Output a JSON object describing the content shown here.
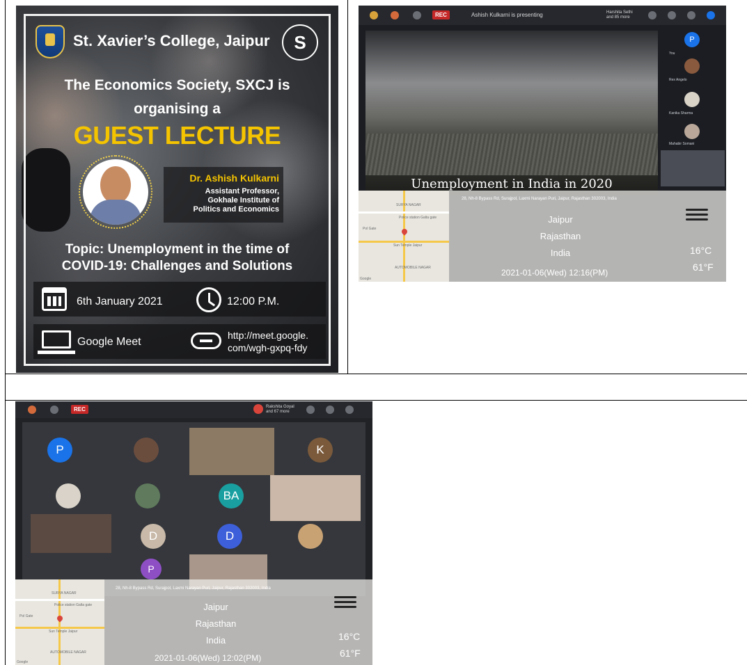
{
  "poster": {
    "college": "St. Xavier’s College, Jaipur",
    "society_logo_letter": "S",
    "line1": "The Economics Society, SXCJ is",
    "line2": "organising a",
    "event_type": "GUEST LECTURE",
    "speaker_name": "Dr. Ashish Kulkarni",
    "speaker_role_1": "Assistant Professor,",
    "speaker_role_2": "Gokhale Institute of",
    "speaker_role_3": "Politics and Economics",
    "topic_1": "Topic: Unemployment in the time of",
    "topic_2": "COVID-19: Challenges and Solutions",
    "date": "6th January 2021",
    "time": "12:00 P.M.",
    "platform": "Google Meet",
    "url_1": "http://meet.google.",
    "url_2": "com/wgh-gxpq-fdy",
    "icons": [
      "calendar-icon",
      "clock-icon",
      "laptop-icon",
      "link-icon"
    ]
  },
  "shot1": {
    "rec_label": "REC",
    "presenting": "Ashish Kulkarni is presenting",
    "more_1": "Harshita Sethi",
    "more_2": "and 85 more",
    "slide_title": "Unemployment in India in 2020",
    "participants": [
      {
        "initial": "P",
        "name": ""
      },
      {
        "initial": "",
        "name": "You"
      },
      {
        "initial": "",
        "name": "Rex Angelo"
      },
      {
        "initial": "",
        "name": "Kanika Sharma"
      },
      {
        "initial": "",
        "name": "Mahabir Somani"
      }
    ],
    "address": "28, Nh-8 Bypass Rd, Surajpol, Laxmi Narayan Puri, Jaipur, Rajasthan 302003, India",
    "city": "Jaipur",
    "state": "Rajasthan",
    "country": "India",
    "temp_c": "16°C",
    "temp_f": "61°F",
    "datetime": "2021-01-06(Wed)   12:16(PM)",
    "map_labels": [
      "SURYA NAGAR",
      "Police station Galta gate",
      "Pol Gate",
      "Sun Temple Jaipur",
      "AUTOMOBILE NAGAR",
      "Google"
    ]
  },
  "shot2": {
    "rec_label": "REC",
    "more_1": "Rakshita Goyal",
    "more_2": "and 67 more",
    "tiles": [
      "P",
      "K",
      "BA",
      "D",
      "D",
      "P"
    ],
    "address": "28, Nh-8 Bypass Rd, Surajpol, Laxmi Narayan Puri, Jaipur, Rajasthan 302003, India",
    "city": "Jaipur",
    "state": "Rajasthan",
    "country": "India",
    "temp_c": "16°C",
    "temp_f": "61°F",
    "datetime": "2021-01-06(Wed)   12:02(PM)",
    "map_labels": [
      "SURYA NAGAR",
      "Police station Galta gate",
      "Pol Gate",
      "Sun Temple Jaipur",
      "AUTOMOBILE NAGAR",
      "Google"
    ]
  },
  "colors": {
    "gold": "#f5c400",
    "rec_red": "#c62828",
    "avatar_blue": "#1a73e8",
    "avatar_purple": "#8e4fc5"
  }
}
